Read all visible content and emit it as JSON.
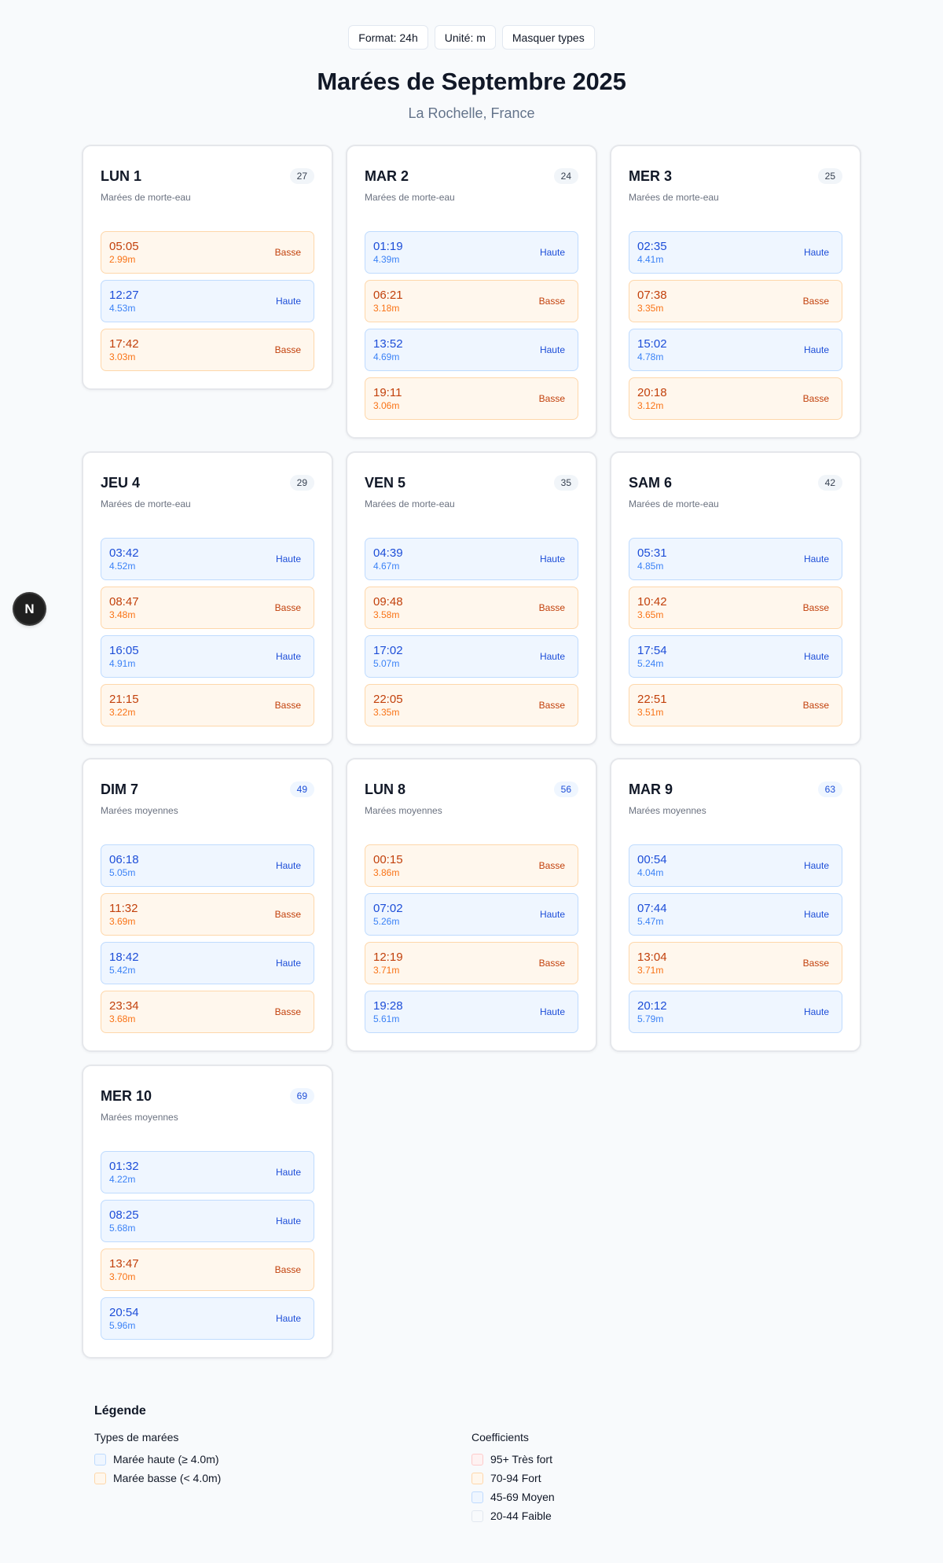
{
  "toolbar": {
    "format_label": "Format: 24h",
    "unit_label": "Unité: m",
    "hide_types_label": "Masquer types"
  },
  "header": {
    "title": "Marées de Septembre 2025",
    "subtitle": "La Rochelle, France"
  },
  "colors": {
    "haute_bg": "#eff6ff",
    "haute_text": "#1d4ed8",
    "basse_bg": "#fff7ed",
    "basse_text": "#c2410c"
  },
  "days": [
    {
      "name": "LUN 1",
      "coef": "27",
      "level": "faible",
      "type": "Marées de morte-eau",
      "tides": [
        {
          "time": "05:05",
          "height": "2.99m",
          "kind": "basse",
          "label": "Basse"
        },
        {
          "time": "12:27",
          "height": "4.53m",
          "kind": "haute",
          "label": "Haute"
        },
        {
          "time": "17:42",
          "height": "3.03m",
          "kind": "basse",
          "label": "Basse"
        }
      ]
    },
    {
      "name": "MAR 2",
      "coef": "24",
      "level": "faible",
      "type": "Marées de morte-eau",
      "tides": [
        {
          "time": "01:19",
          "height": "4.39m",
          "kind": "haute",
          "label": "Haute"
        },
        {
          "time": "06:21",
          "height": "3.18m",
          "kind": "basse",
          "label": "Basse"
        },
        {
          "time": "13:52",
          "height": "4.69m",
          "kind": "haute",
          "label": "Haute"
        },
        {
          "time": "19:11",
          "height": "3.06m",
          "kind": "basse",
          "label": "Basse"
        }
      ]
    },
    {
      "name": "MER 3",
      "coef": "25",
      "level": "faible",
      "type": "Marées de morte-eau",
      "tides": [
        {
          "time": "02:35",
          "height": "4.41m",
          "kind": "haute",
          "label": "Haute"
        },
        {
          "time": "07:38",
          "height": "3.35m",
          "kind": "basse",
          "label": "Basse"
        },
        {
          "time": "15:02",
          "height": "4.78m",
          "kind": "haute",
          "label": "Haute"
        },
        {
          "time": "20:18",
          "height": "3.12m",
          "kind": "basse",
          "label": "Basse"
        }
      ]
    },
    {
      "name": "JEU 4",
      "coef": "29",
      "level": "faible",
      "type": "Marées de morte-eau",
      "tides": [
        {
          "time": "03:42",
          "height": "4.52m",
          "kind": "haute",
          "label": "Haute"
        },
        {
          "time": "08:47",
          "height": "3.48m",
          "kind": "basse",
          "label": "Basse"
        },
        {
          "time": "16:05",
          "height": "4.91m",
          "kind": "haute",
          "label": "Haute"
        },
        {
          "time": "21:15",
          "height": "3.22m",
          "kind": "basse",
          "label": "Basse"
        }
      ]
    },
    {
      "name": "VEN 5",
      "coef": "35",
      "level": "faible",
      "type": "Marées de morte-eau",
      "tides": [
        {
          "time": "04:39",
          "height": "4.67m",
          "kind": "haute",
          "label": "Haute"
        },
        {
          "time": "09:48",
          "height": "3.58m",
          "kind": "basse",
          "label": "Basse"
        },
        {
          "time": "17:02",
          "height": "5.07m",
          "kind": "haute",
          "label": "Haute"
        },
        {
          "time": "22:05",
          "height": "3.35m",
          "kind": "basse",
          "label": "Basse"
        }
      ]
    },
    {
      "name": "SAM 6",
      "coef": "42",
      "level": "faible",
      "type": "Marées de morte-eau",
      "tides": [
        {
          "time": "05:31",
          "height": "4.85m",
          "kind": "haute",
          "label": "Haute"
        },
        {
          "time": "10:42",
          "height": "3.65m",
          "kind": "basse",
          "label": "Basse"
        },
        {
          "time": "17:54",
          "height": "5.24m",
          "kind": "haute",
          "label": "Haute"
        },
        {
          "time": "22:51",
          "height": "3.51m",
          "kind": "basse",
          "label": "Basse"
        }
      ]
    },
    {
      "name": "DIM 7",
      "coef": "49",
      "level": "moyen",
      "type": "Marées moyennes",
      "tides": [
        {
          "time": "06:18",
          "height": "5.05m",
          "kind": "haute",
          "label": "Haute"
        },
        {
          "time": "11:32",
          "height": "3.69m",
          "kind": "basse",
          "label": "Basse"
        },
        {
          "time": "18:42",
          "height": "5.42m",
          "kind": "haute",
          "label": "Haute"
        },
        {
          "time": "23:34",
          "height": "3.68m",
          "kind": "basse",
          "label": "Basse"
        }
      ]
    },
    {
      "name": "LUN 8",
      "coef": "56",
      "level": "moyen",
      "type": "Marées moyennes",
      "tides": [
        {
          "time": "00:15",
          "height": "3.86m",
          "kind": "basse",
          "label": "Basse"
        },
        {
          "time": "07:02",
          "height": "5.26m",
          "kind": "haute",
          "label": "Haute"
        },
        {
          "time": "12:19",
          "height": "3.71m",
          "kind": "basse",
          "label": "Basse"
        },
        {
          "time": "19:28",
          "height": "5.61m",
          "kind": "haute",
          "label": "Haute"
        }
      ]
    },
    {
      "name": "MAR 9",
      "coef": "63",
      "level": "moyen",
      "type": "Marées moyennes",
      "tides": [
        {
          "time": "00:54",
          "height": "4.04m",
          "kind": "haute",
          "label": "Haute"
        },
        {
          "time": "07:44",
          "height": "5.47m",
          "kind": "haute",
          "label": "Haute"
        },
        {
          "time": "13:04",
          "height": "3.71m",
          "kind": "basse",
          "label": "Basse"
        },
        {
          "time": "20:12",
          "height": "5.79m",
          "kind": "haute",
          "label": "Haute"
        }
      ]
    },
    {
      "name": "MER 10",
      "coef": "69",
      "level": "moyen",
      "type": "Marées moyennes",
      "tides": [
        {
          "time": "01:32",
          "height": "4.22m",
          "kind": "haute",
          "label": "Haute"
        },
        {
          "time": "08:25",
          "height": "5.68m",
          "kind": "haute",
          "label": "Haute"
        },
        {
          "time": "13:47",
          "height": "3.70m",
          "kind": "basse",
          "label": "Basse"
        },
        {
          "time": "20:54",
          "height": "5.96m",
          "kind": "haute",
          "label": "Haute"
        }
      ]
    }
  ],
  "legend": {
    "title": "Légende",
    "types_title": "Types de marées",
    "types": [
      {
        "label": "Marée haute (≥ 4.0m)",
        "bg": "#eff6ff",
        "border": "#bfdbfe"
      },
      {
        "label": "Marée basse (< 4.0m)",
        "bg": "#fff7ed",
        "border": "#fed7aa"
      }
    ],
    "coefs_title": "Coefficients",
    "coefs": [
      {
        "label": "95+ Très fort",
        "bg": "#fef2f2",
        "border": "#fecaca"
      },
      {
        "label": "70-94 Fort",
        "bg": "#fff7ed",
        "border": "#fed7aa"
      },
      {
        "label": "45-69 Moyen",
        "bg": "#eff6ff",
        "border": "#bfdbfe"
      },
      {
        "label": "20-44 Faible",
        "bg": "#f8fafc",
        "border": "#e2e8f0"
      }
    ]
  },
  "dev_badge": {
    "letter": "N",
    "icon": "nextjs-icon"
  }
}
